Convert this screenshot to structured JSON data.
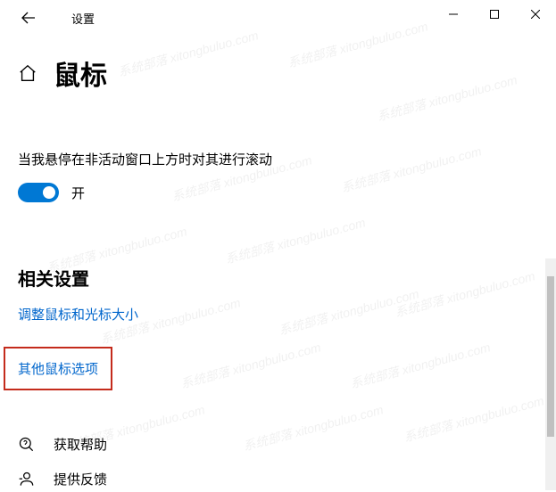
{
  "titlebar": {
    "title": "设置"
  },
  "header": {
    "page_title": "鼠标"
  },
  "settings": {
    "scroll_inactive_label": "当我悬停在非活动窗口上方时对其进行滚动",
    "toggle_state": "开"
  },
  "related": {
    "heading": "相关设置",
    "link_cursor_size": "调整鼠标和光标大小",
    "link_more_options": "其他鼠标选项"
  },
  "help": {
    "get_help": "获取帮助",
    "feedback": "提供反馈"
  },
  "watermark_text": "系统部落 xitongbuluo.com"
}
